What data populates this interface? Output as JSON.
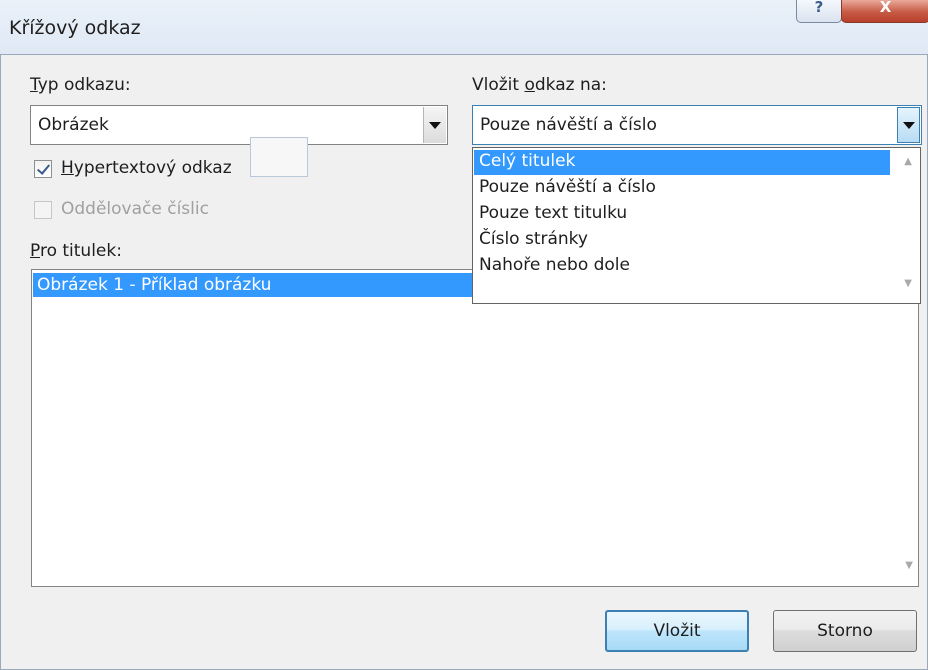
{
  "dialog": {
    "title": "Křížový odkaz"
  },
  "caption_buttons": {
    "help_glyph": "?",
    "close_glyph": "X"
  },
  "reference_type": {
    "label_pre": "",
    "label_ul": "T",
    "label_post": "yp odkazu:",
    "value": "Obrázek"
  },
  "insert_reference_to": {
    "label_pre": "Vložit ",
    "label_ul": "o",
    "label_post": "dkaz na:",
    "value": "Pouze návěští a číslo",
    "options": [
      "Celý titulek",
      "Pouze návěští a číslo",
      "Pouze text titulku",
      "Číslo stránky",
      "Nahoře nebo dole"
    ],
    "highlighted_index": 0
  },
  "hyperlink_checkbox": {
    "label_ul": "H",
    "label_post": "ypertextový odkaz",
    "checked": true
  },
  "separators_checkbox": {
    "label": "Oddělovače číslic",
    "checked": false,
    "enabled": false
  },
  "for_caption": {
    "label_ul": "P",
    "label_post": "ro titulek:",
    "items": [
      "Obrázek 1 - Příklad obrázku"
    ],
    "selected_index": 0
  },
  "buttons": {
    "insert": "Vložit",
    "cancel": "Storno"
  },
  "colors": {
    "selection": "#3399ff",
    "title_bar": "#dfe9f5",
    "dialog_bg": "#f0f0f0"
  }
}
